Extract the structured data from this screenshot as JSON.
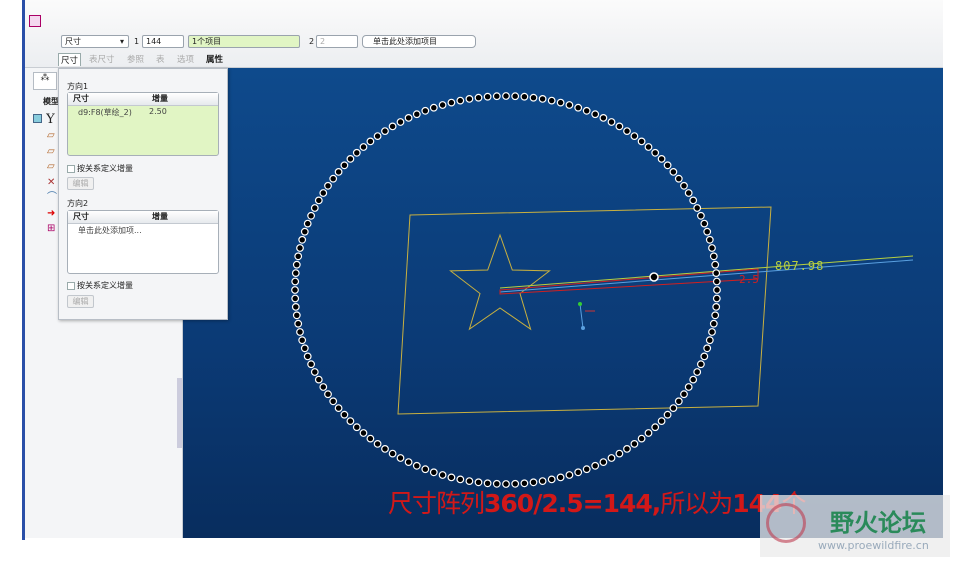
{
  "toolbar": {
    "type_select": "尺寸",
    "dir1_label": "1",
    "dir1_count": "144",
    "dir1_items": "1个项目",
    "dir2_label": "2",
    "dir2_count": "2",
    "dir2_add": "单击此处添加项目"
  },
  "tabs": [
    "尺寸",
    "表尺寸",
    "参照",
    "表",
    "选项",
    "属性"
  ],
  "tree": {
    "tab_label": "模型",
    "root": "Y"
  },
  "dialog": {
    "dir1_title": "方向1",
    "col_dim": "尺寸",
    "col_inc": "增量",
    "row_dim": "d9:F8(草绘_2)",
    "row_inc": "2.50",
    "rel_label": "按关系定义增量",
    "edit": "编辑",
    "dir2_title": "方向2",
    "add_item": "单击此处添加项..."
  },
  "canvas": {
    "dimension": "807.98",
    "angle_dim": "2.5",
    "pattern_count": 144
  },
  "caption": {
    "part1": "尺寸阵列",
    "part2": "360/2.5=144,",
    "part3": "所以为",
    "part4": "144",
    "part5": "个"
  },
  "watermark": {
    "name": "野火论坛",
    "url": "www.proewildfire.cn"
  }
}
